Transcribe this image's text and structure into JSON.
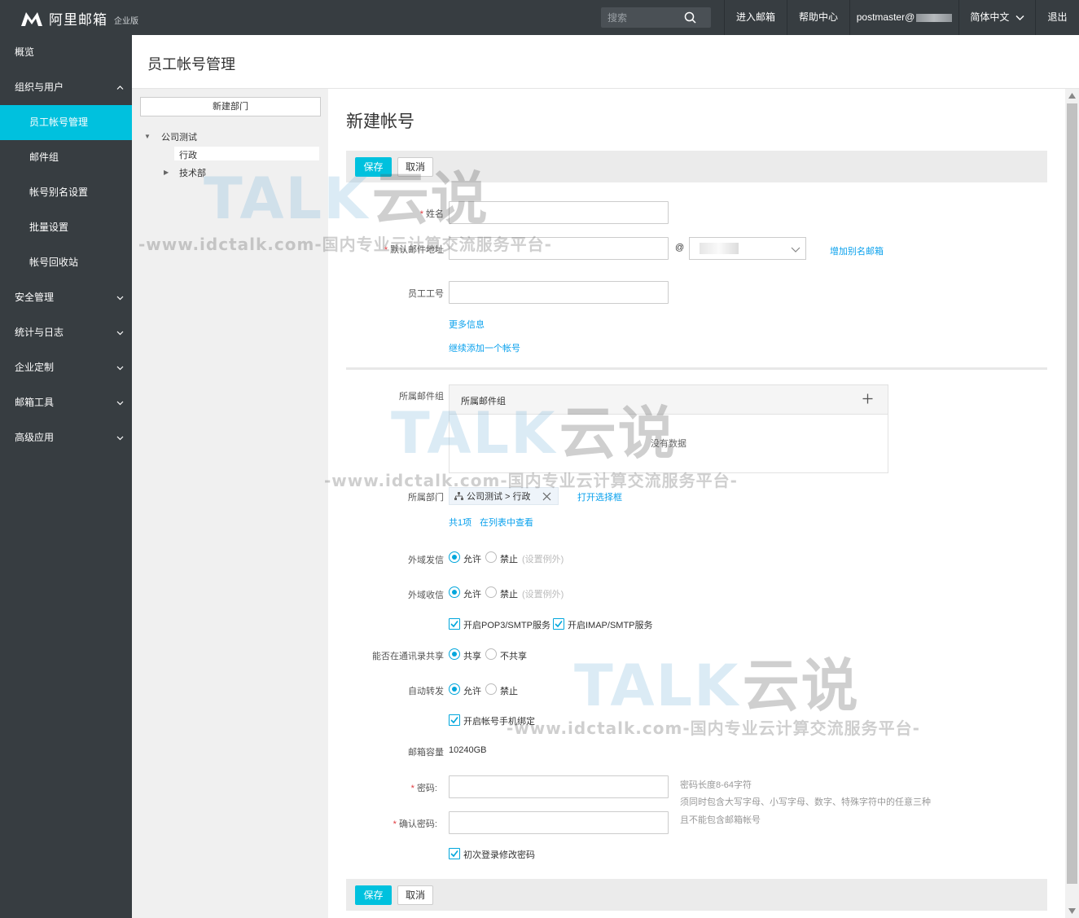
{
  "topbar": {
    "logo_text": "阿里邮箱",
    "logo_sub": "企业版",
    "search_placeholder": "搜索",
    "nav": {
      "enter_mailbox": "进入邮箱",
      "help": "帮助中心",
      "user": "postmaster@",
      "language": "简体中文",
      "logout": "退出"
    }
  },
  "sidebar": {
    "items": [
      {
        "label": "概览"
      },
      {
        "label": "组织与用户"
      },
      {
        "label": "员工帐号管理"
      },
      {
        "label": "邮件组"
      },
      {
        "label": "帐号别名设置"
      },
      {
        "label": "批量设置"
      },
      {
        "label": "帐号回收站"
      },
      {
        "label": "安全管理"
      },
      {
        "label": "统计与日志"
      },
      {
        "label": "企业定制"
      },
      {
        "label": "邮箱工具"
      },
      {
        "label": "高级应用"
      }
    ]
  },
  "header": {
    "title": "员工帐号管理"
  },
  "dept_panel": {
    "new_dept": "新建部门",
    "tree": {
      "root": "公司测试",
      "children": [
        "行政",
        "技术部"
      ]
    }
  },
  "form": {
    "title": "新建帐号",
    "save": "保存",
    "cancel": "取消",
    "name_label": "姓名",
    "email_label": "默认邮件地址",
    "at": "@",
    "add_alias": "增加别名邮箱",
    "emp_id_label": "员工工号",
    "more_info": "更多信息",
    "continue_add": "继续添加一个帐号",
    "mail_group_label": "所属邮件组",
    "mail_group_head": "所属邮件组",
    "no_data": "没有数据",
    "dept_label": "所属部门",
    "dept_tag": "公司测试 > 行政",
    "open_selector": "打开选择框",
    "total": "共1项",
    "view_in_list": "在列表中查看",
    "ext_send_label": "外域发信",
    "ext_recv_label": "外域收信",
    "allow": "允许",
    "deny": "禁止",
    "set_exception": "(设置例外)",
    "pop3": "开启POP3/SMTP服务",
    "imap": "开启IMAP/SMTP服务",
    "share_label": "能否在通讯录共享",
    "share": "共享",
    "no_share": "不共享",
    "forward_label": "自动转发",
    "bind_phone": "开启帐号手机绑定",
    "capacity_label": "邮箱容量",
    "capacity_value": "10240GB",
    "password_label": "密码:",
    "confirm_label": "确认密码:",
    "pw_hint1": "密码长度8-64字符",
    "pw_hint2": "须同时包含大写字母、小写字母、数字、特殊字符中的任意三种",
    "pw_hint3": "且不能包含邮箱帐号",
    "first_login": "初次登录修改密码"
  },
  "watermark": {
    "brand": "TALK",
    "yun": "云说",
    "sub": "-www.idctalk.com-国内专业云计算交流服务平台-"
  },
  "colors": {
    "topbar": "#373d41",
    "accent": "#00c1de",
    "link": "#0aa1ed",
    "required": "#e0393e"
  }
}
